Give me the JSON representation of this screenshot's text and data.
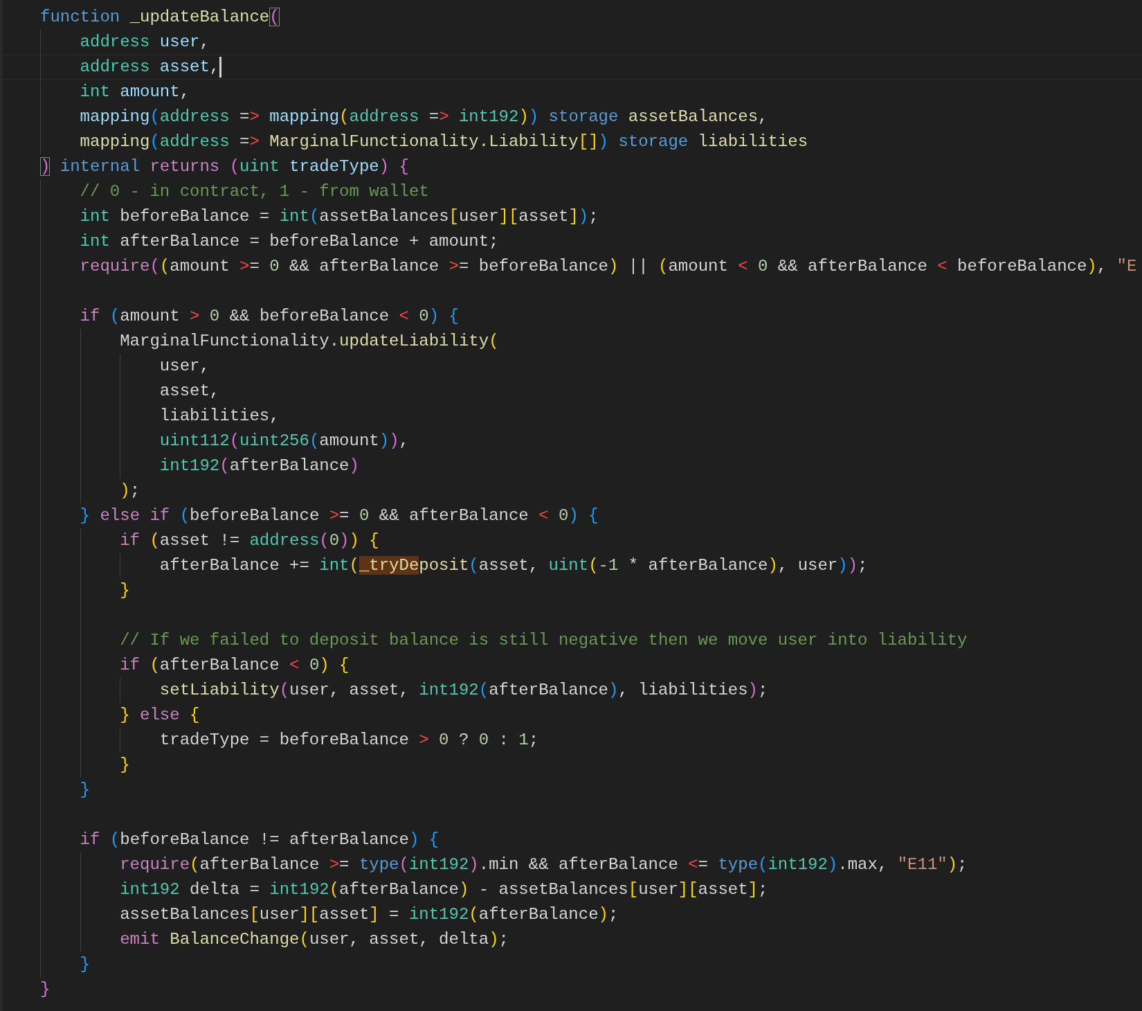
{
  "editor": {
    "lines": [
      {
        "tokens": [
          {
            "kind": "kw",
            "text": "function"
          },
          {
            "kind": "fn",
            "text": " _updateBalance"
          },
          {
            "kind": "b2",
            "text": "(",
            "matched": true
          }
        ]
      },
      {
        "tokens": [
          {
            "kind": "type",
            "text": "    address"
          },
          {
            "kind": "param",
            "text": " user"
          },
          {
            "kind": "plain",
            "text": ","
          }
        ]
      },
      {
        "current": true,
        "tokens": [
          {
            "kind": "type",
            "text": "    address"
          },
          {
            "kind": "param",
            "text": " asset"
          },
          {
            "kind": "plain",
            "text": ","
          }
        ]
      },
      {
        "tokens": [
          {
            "kind": "type",
            "text": "    int"
          },
          {
            "kind": "param",
            "text": " amount"
          },
          {
            "kind": "plain",
            "text": ","
          }
        ]
      },
      {
        "tokens": [
          {
            "kind": "param",
            "text": "    mapping"
          },
          {
            "kind": "b3",
            "text": "("
          },
          {
            "kind": "type",
            "text": "address"
          },
          {
            "kind": "plain",
            "text": " ="
          },
          {
            "kind": "op",
            "text": ">"
          },
          {
            "kind": "param",
            "text": " mapping"
          },
          {
            "kind": "b1",
            "text": "("
          },
          {
            "kind": "type",
            "text": "address"
          },
          {
            "kind": "plain",
            "text": " ="
          },
          {
            "kind": "op",
            "text": ">"
          },
          {
            "kind": "type",
            "text": " int192"
          },
          {
            "kind": "b1",
            "text": ")"
          },
          {
            "kind": "b3",
            "text": ")"
          },
          {
            "kind": "kw",
            "text": " storage"
          },
          {
            "kind": "fn",
            "text": " assetBalances"
          },
          {
            "kind": "plain",
            "text": ","
          }
        ]
      },
      {
        "tokens": [
          {
            "kind": "fn",
            "text": "    mapping"
          },
          {
            "kind": "b3",
            "text": "("
          },
          {
            "kind": "type",
            "text": "address"
          },
          {
            "kind": "plain",
            "text": " ="
          },
          {
            "kind": "op",
            "text": ">"
          },
          {
            "kind": "fn",
            "text": " MarginalFunctionality.Liability"
          },
          {
            "kind": "b1",
            "text": "[]"
          },
          {
            "kind": "b3",
            "text": ")"
          },
          {
            "kind": "kw",
            "text": " storage"
          },
          {
            "kind": "fn",
            "text": " liabilities"
          }
        ]
      },
      {
        "tokens": [
          {
            "kind": "b2",
            "text": ")",
            "matched": true
          },
          {
            "kind": "kw",
            "text": " internal"
          },
          {
            "kind": "ctrl",
            "text": " returns"
          },
          {
            "kind": "b2",
            "text": " ("
          },
          {
            "kind": "type",
            "text": "uint"
          },
          {
            "kind": "param",
            "text": " tradeType"
          },
          {
            "kind": "b2",
            "text": ")"
          },
          {
            "kind": "b2",
            "text": " {"
          }
        ]
      },
      {
        "tokens": [
          {
            "kind": "cmt",
            "text": "    // 0 - in contract, 1 - from wallet"
          }
        ]
      },
      {
        "tokens": [
          {
            "kind": "type",
            "text": "    int"
          },
          {
            "kind": "plain",
            "text": " beforeBalance = "
          },
          {
            "kind": "type",
            "text": "int"
          },
          {
            "kind": "b3",
            "text": "("
          },
          {
            "kind": "plain",
            "text": "assetBalances"
          },
          {
            "kind": "b1",
            "text": "["
          },
          {
            "kind": "plain",
            "text": "user"
          },
          {
            "kind": "b1",
            "text": "]["
          },
          {
            "kind": "plain",
            "text": "asset"
          },
          {
            "kind": "b1",
            "text": "]"
          },
          {
            "kind": "b3",
            "text": ")"
          },
          {
            "kind": "plain",
            "text": ";"
          }
        ]
      },
      {
        "tokens": [
          {
            "kind": "type",
            "text": "    int"
          },
          {
            "kind": "plain",
            "text": " afterBalance = beforeBalance + amount;"
          }
        ]
      },
      {
        "tokens": [
          {
            "kind": "ctrl",
            "text": "    require"
          },
          {
            "kind": "b2",
            "text": "("
          },
          {
            "kind": "b1",
            "text": "("
          },
          {
            "kind": "plain",
            "text": "amount "
          },
          {
            "kind": "op",
            "text": ">"
          },
          {
            "kind": "plain",
            "text": "= "
          },
          {
            "kind": "num",
            "text": "0"
          },
          {
            "kind": "plain",
            "text": " && afterBalance "
          },
          {
            "kind": "op",
            "text": ">"
          },
          {
            "kind": "plain",
            "text": "= beforeBalance"
          },
          {
            "kind": "b1",
            "text": ")"
          },
          {
            "kind": "plain",
            "text": " || "
          },
          {
            "kind": "b1",
            "text": "("
          },
          {
            "kind": "plain",
            "text": "amount "
          },
          {
            "kind": "op",
            "text": "<"
          },
          {
            "kind": "num",
            "text": " 0"
          },
          {
            "kind": "plain",
            "text": " && afterBalance "
          },
          {
            "kind": "op",
            "text": "<"
          },
          {
            "kind": "plain",
            "text": " beforeBalance"
          },
          {
            "kind": "b1",
            "text": ")"
          },
          {
            "kind": "plain",
            "text": ", "
          },
          {
            "kind": "str",
            "text": "\"E"
          }
        ]
      },
      {
        "kind": "blank"
      },
      {
        "tokens": [
          {
            "kind": "ctrl",
            "text": "    if"
          },
          {
            "kind": "b3",
            "text": " ("
          },
          {
            "kind": "plain",
            "text": "amount "
          },
          {
            "kind": "op",
            "text": ">"
          },
          {
            "kind": "num",
            "text": " 0"
          },
          {
            "kind": "plain",
            "text": " && beforeBalance "
          },
          {
            "kind": "op",
            "text": "<"
          },
          {
            "kind": "num",
            "text": " 0"
          },
          {
            "kind": "b3",
            "text": ")"
          },
          {
            "kind": "b3",
            "text": " {"
          }
        ]
      },
      {
        "tokens": [
          {
            "kind": "plain",
            "text": "        MarginalFunctionality."
          },
          {
            "kind": "fn",
            "text": "updateLiability"
          },
          {
            "kind": "b1",
            "text": "("
          }
        ]
      },
      {
        "tokens": [
          {
            "kind": "plain",
            "text": "            user,"
          }
        ]
      },
      {
        "tokens": [
          {
            "kind": "plain",
            "text": "            asset,"
          }
        ]
      },
      {
        "tokens": [
          {
            "kind": "plain",
            "text": "            liabilities,"
          }
        ]
      },
      {
        "tokens": [
          {
            "kind": "type",
            "text": "            uint112"
          },
          {
            "kind": "b2",
            "text": "("
          },
          {
            "kind": "type",
            "text": "uint256"
          },
          {
            "kind": "b3",
            "text": "("
          },
          {
            "kind": "plain",
            "text": "amount"
          },
          {
            "kind": "b3",
            "text": ")"
          },
          {
            "kind": "b2",
            "text": ")"
          },
          {
            "kind": "plain",
            "text": ","
          }
        ]
      },
      {
        "tokens": [
          {
            "kind": "type",
            "text": "            int192"
          },
          {
            "kind": "b2",
            "text": "("
          },
          {
            "kind": "plain",
            "text": "afterBalance"
          },
          {
            "kind": "b2",
            "text": ")"
          }
        ]
      },
      {
        "tokens": [
          {
            "kind": "b1",
            "text": "        )"
          },
          {
            "kind": "plain",
            "text": ";"
          }
        ]
      },
      {
        "tokens": [
          {
            "kind": "b3",
            "text": "    }"
          },
          {
            "kind": "ctrl",
            "text": " else"
          },
          {
            "kind": "ctrl",
            "text": " if"
          },
          {
            "kind": "b3",
            "text": " ("
          },
          {
            "kind": "plain",
            "text": "beforeBalance "
          },
          {
            "kind": "op",
            "text": ">"
          },
          {
            "kind": "plain",
            "text": "= "
          },
          {
            "kind": "num",
            "text": "0"
          },
          {
            "kind": "plain",
            "text": " && afterBalance "
          },
          {
            "kind": "op",
            "text": "<"
          },
          {
            "kind": "num",
            "text": " 0"
          },
          {
            "kind": "b3",
            "text": ")"
          },
          {
            "kind": "b3",
            "text": " {"
          }
        ]
      },
      {
        "tokens": [
          {
            "kind": "ctrl",
            "text": "        if"
          },
          {
            "kind": "b1",
            "text": " ("
          },
          {
            "kind": "plain",
            "text": "asset != "
          },
          {
            "kind": "type",
            "text": "address"
          },
          {
            "kind": "b2",
            "text": "("
          },
          {
            "kind": "num",
            "text": "0"
          },
          {
            "kind": "b2",
            "text": ")"
          },
          {
            "kind": "b1",
            "text": ")"
          },
          {
            "kind": "b1",
            "text": " {"
          }
        ]
      },
      {
        "tokens": [
          {
            "kind": "plain",
            "text": "            afterBalance += "
          },
          {
            "kind": "type",
            "text": "int"
          },
          {
            "kind": "b1",
            "text": "("
          },
          {
            "kind": "fn",
            "text": "_tryDe",
            "highlighted": true
          },
          {
            "kind": "fn",
            "text": "posit"
          },
          {
            "kind": "b3",
            "text": "("
          },
          {
            "kind": "plain",
            "text": "asset, "
          },
          {
            "kind": "type",
            "text": "uint"
          },
          {
            "kind": "b1",
            "text": "("
          },
          {
            "kind": "num",
            "text": "-1"
          },
          {
            "kind": "plain",
            "text": " * afterBalance"
          },
          {
            "kind": "b1",
            "text": ")"
          },
          {
            "kind": "plain",
            "text": ", user"
          },
          {
            "kind": "b3",
            "text": ")"
          },
          {
            "kind": "b2",
            "text": ")"
          },
          {
            "kind": "plain",
            "text": ";"
          }
        ]
      },
      {
        "tokens": [
          {
            "kind": "b1",
            "text": "        }"
          }
        ]
      },
      {
        "kind": "blank"
      },
      {
        "tokens": [
          {
            "kind": "cmt",
            "text": "        // If we failed to deposit balance is still negative then we move user into liability"
          }
        ]
      },
      {
        "tokens": [
          {
            "kind": "ctrl",
            "text": "        if"
          },
          {
            "kind": "b1",
            "text": " ("
          },
          {
            "kind": "plain",
            "text": "afterBalance "
          },
          {
            "kind": "op",
            "text": "<"
          },
          {
            "kind": "num",
            "text": " 0"
          },
          {
            "kind": "b1",
            "text": ")"
          },
          {
            "kind": "b1",
            "text": " {"
          }
        ]
      },
      {
        "tokens": [
          {
            "kind": "fn",
            "text": "            setLiability"
          },
          {
            "kind": "b2",
            "text": "("
          },
          {
            "kind": "plain",
            "text": "user, asset, "
          },
          {
            "kind": "type",
            "text": "int192"
          },
          {
            "kind": "b3",
            "text": "("
          },
          {
            "kind": "plain",
            "text": "afterBalance"
          },
          {
            "kind": "b3",
            "text": ")"
          },
          {
            "kind": "plain",
            "text": ", liabilities"
          },
          {
            "kind": "b2",
            "text": ")"
          },
          {
            "kind": "plain",
            "text": ";"
          }
        ]
      },
      {
        "tokens": [
          {
            "kind": "b1",
            "text": "        }"
          },
          {
            "kind": "ctrl",
            "text": " else"
          },
          {
            "kind": "b1",
            "text": " {"
          }
        ]
      },
      {
        "tokens": [
          {
            "kind": "plain",
            "text": "            tradeType = beforeBalance "
          },
          {
            "kind": "op",
            "text": ">"
          },
          {
            "kind": "num",
            "text": " 0"
          },
          {
            "kind": "plain",
            "text": " ? "
          },
          {
            "kind": "num",
            "text": "0"
          },
          {
            "kind": "plain",
            "text": " : "
          },
          {
            "kind": "num",
            "text": "1"
          },
          {
            "kind": "plain",
            "text": ";"
          }
        ]
      },
      {
        "tokens": [
          {
            "kind": "b1",
            "text": "        }"
          }
        ]
      },
      {
        "tokens": [
          {
            "kind": "b3",
            "text": "    }"
          }
        ]
      },
      {
        "kind": "blank"
      },
      {
        "tokens": [
          {
            "kind": "ctrl",
            "text": "    if"
          },
          {
            "kind": "b3",
            "text": " ("
          },
          {
            "kind": "plain",
            "text": "beforeBalance != afterBalance"
          },
          {
            "kind": "b3",
            "text": ")"
          },
          {
            "kind": "b3",
            "text": " {"
          }
        ]
      },
      {
        "tokens": [
          {
            "kind": "ctrl",
            "text": "        require"
          },
          {
            "kind": "b1",
            "text": "("
          },
          {
            "kind": "plain",
            "text": "afterBalance "
          },
          {
            "kind": "op",
            "text": ">"
          },
          {
            "kind": "plain",
            "text": "= "
          },
          {
            "kind": "kw",
            "text": "type"
          },
          {
            "kind": "b2",
            "text": "("
          },
          {
            "kind": "type",
            "text": "int192"
          },
          {
            "kind": "b2",
            "text": ")"
          },
          {
            "kind": "plain",
            "text": ".min && afterBalance "
          },
          {
            "kind": "op",
            "text": "<"
          },
          {
            "kind": "plain",
            "text": "= "
          },
          {
            "kind": "kw",
            "text": "type"
          },
          {
            "kind": "b3",
            "text": "("
          },
          {
            "kind": "type",
            "text": "int192"
          },
          {
            "kind": "b3",
            "text": ")"
          },
          {
            "kind": "plain",
            "text": ".max, "
          },
          {
            "kind": "str",
            "text": "\"E11\""
          },
          {
            "kind": "b1",
            "text": ")"
          },
          {
            "kind": "plain",
            "text": ";"
          }
        ]
      },
      {
        "tokens": [
          {
            "kind": "type",
            "text": "        int192"
          },
          {
            "kind": "plain",
            "text": " delta = "
          },
          {
            "kind": "type",
            "text": "int192"
          },
          {
            "kind": "b1",
            "text": "("
          },
          {
            "kind": "plain",
            "text": "afterBalance"
          },
          {
            "kind": "b1",
            "text": ")"
          },
          {
            "kind": "plain",
            "text": " - assetBalances"
          },
          {
            "kind": "b1",
            "text": "["
          },
          {
            "kind": "plain",
            "text": "user"
          },
          {
            "kind": "b1",
            "text": "]["
          },
          {
            "kind": "plain",
            "text": "asset"
          },
          {
            "kind": "b1",
            "text": "]"
          },
          {
            "kind": "plain",
            "text": ";"
          }
        ]
      },
      {
        "tokens": [
          {
            "kind": "plain",
            "text": "        assetBalances"
          },
          {
            "kind": "b1",
            "text": "["
          },
          {
            "kind": "plain",
            "text": "user"
          },
          {
            "kind": "b1",
            "text": "]["
          },
          {
            "kind": "plain",
            "text": "asset"
          },
          {
            "kind": "b1",
            "text": "]"
          },
          {
            "kind": "plain",
            "text": " = "
          },
          {
            "kind": "type",
            "text": "int192"
          },
          {
            "kind": "b1",
            "text": "("
          },
          {
            "kind": "plain",
            "text": "afterBalance"
          },
          {
            "kind": "b1",
            "text": ")"
          },
          {
            "kind": "plain",
            "text": ";"
          }
        ]
      },
      {
        "tokens": [
          {
            "kind": "ctrl",
            "text": "        emit"
          },
          {
            "kind": "fn",
            "text": " BalanceChange"
          },
          {
            "kind": "b1",
            "text": "("
          },
          {
            "kind": "plain",
            "text": "user, asset, delta"
          },
          {
            "kind": "b1",
            "text": ")"
          },
          {
            "kind": "plain",
            "text": ";"
          }
        ]
      },
      {
        "tokens": [
          {
            "kind": "b3",
            "text": "    }"
          }
        ]
      },
      {
        "tokens": [
          {
            "kind": "b2",
            "text": "}"
          }
        ]
      }
    ]
  }
}
